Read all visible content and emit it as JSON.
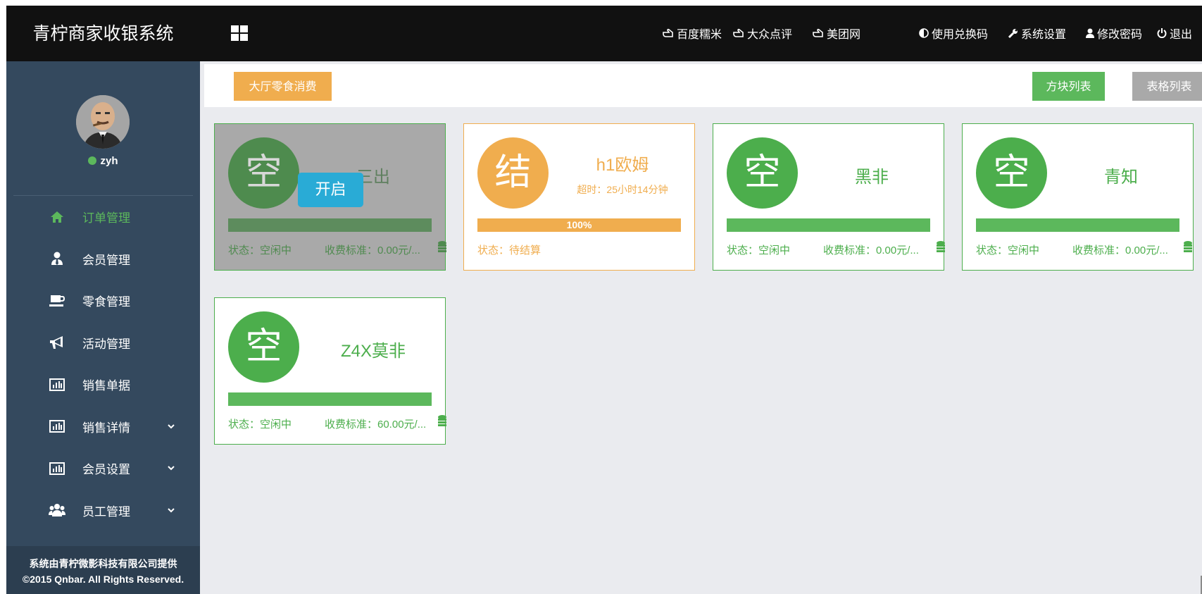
{
  "app_title": "青柠商家收银系统",
  "user": {
    "name": "zyh",
    "status_color": "#5cb85c"
  },
  "sidebar": {
    "items": [
      {
        "label": "订单管理",
        "icon": "home-icon",
        "active": true
      },
      {
        "label": "会员管理",
        "icon": "user-tie-icon"
      },
      {
        "label": "零食管理",
        "icon": "coffee-icon"
      },
      {
        "label": "活动管理",
        "icon": "bullhorn-icon"
      },
      {
        "label": "销售单据",
        "icon": "bar-chart-icon"
      },
      {
        "label": "销售详情",
        "icon": "bar-chart-icon",
        "expandable": true
      },
      {
        "label": "会员设置",
        "icon": "bar-chart-icon",
        "expandable": true
      },
      {
        "label": "员工管理",
        "icon": "users-icon",
        "expandable": true
      }
    ],
    "footer_line1": "系统由青柠微影科技有限公司提供",
    "footer_line2": "©2015 Qnbar. All Rights Reserved."
  },
  "topbar": {
    "links": {
      "baidu": "百度糯米",
      "dianping": "大众点评",
      "meituan": "美团网",
      "redeem": "使用兑换码",
      "settings": "系统设置",
      "password": "修改密码",
      "logout": "退出"
    }
  },
  "toolbar": {
    "hall_snack": "大厅零食消费",
    "block_list": "方块列表",
    "table_list": "表格列表"
  },
  "rooms": [
    {
      "glyph": "空",
      "name": "三出",
      "status": "状态：空闲中",
      "fee": "收费标准：0.00元/...",
      "open_label": "开启"
    },
    {
      "glyph": "结",
      "name": "h1欧姆",
      "overtime": "超时：25小时14分钟",
      "progress": "100%",
      "status": "状态：待结算"
    },
    {
      "glyph": "空",
      "name": "黑非",
      "status": "状态：空闲中",
      "fee": "收费标准：0.00元/..."
    },
    {
      "glyph": "空",
      "name": "青知",
      "status": "状态：空闲中",
      "fee": "收费标准：0.00元/..."
    },
    {
      "glyph": "空",
      "name": "Z4X莫非",
      "status": "状态：空闲中",
      "fee": "收费标准：60.00元/..."
    }
  ],
  "colors": {
    "green": "#5cb85c",
    "orange": "#f0ad4e",
    "sidebar": "#34495e",
    "topbar": "#111111",
    "open_button": "#29abd6"
  }
}
